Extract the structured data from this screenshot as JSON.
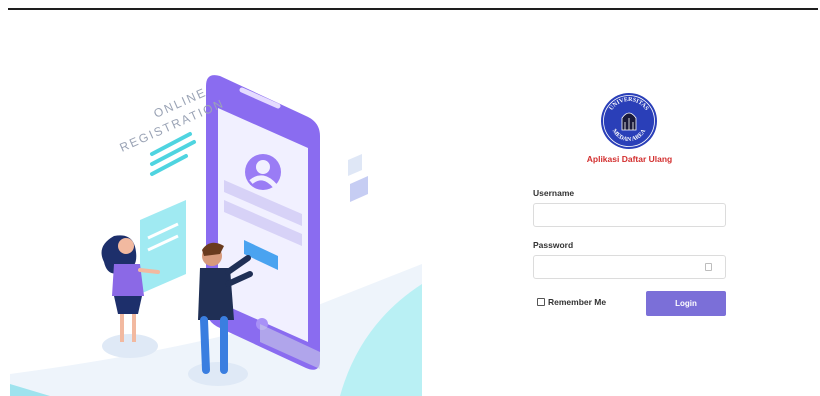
{
  "illustration": {
    "caption_line1": "ONLINE",
    "caption_line2": "REGISTRATION"
  },
  "logo": {
    "text_top": "UNIVERSITAS",
    "text_bottom": "MEDAN AREA"
  },
  "app_title": "Aplikasi Daftar Ulang",
  "form": {
    "username_label": "Username",
    "username_value": "",
    "password_label": "Password",
    "password_value": "",
    "remember_label": "Remember Me",
    "login_label": "Login"
  },
  "colors": {
    "accent": "#7b6fd8",
    "title_red": "#d32f2f",
    "logo_blue": "#2a3fb8",
    "phone_purple": "#8a6cf0",
    "illustration_cyan": "#5ee0e6"
  },
  "icons": {
    "password_toggle": "eye-icon",
    "remember_checkbox": "checkbox-icon"
  }
}
